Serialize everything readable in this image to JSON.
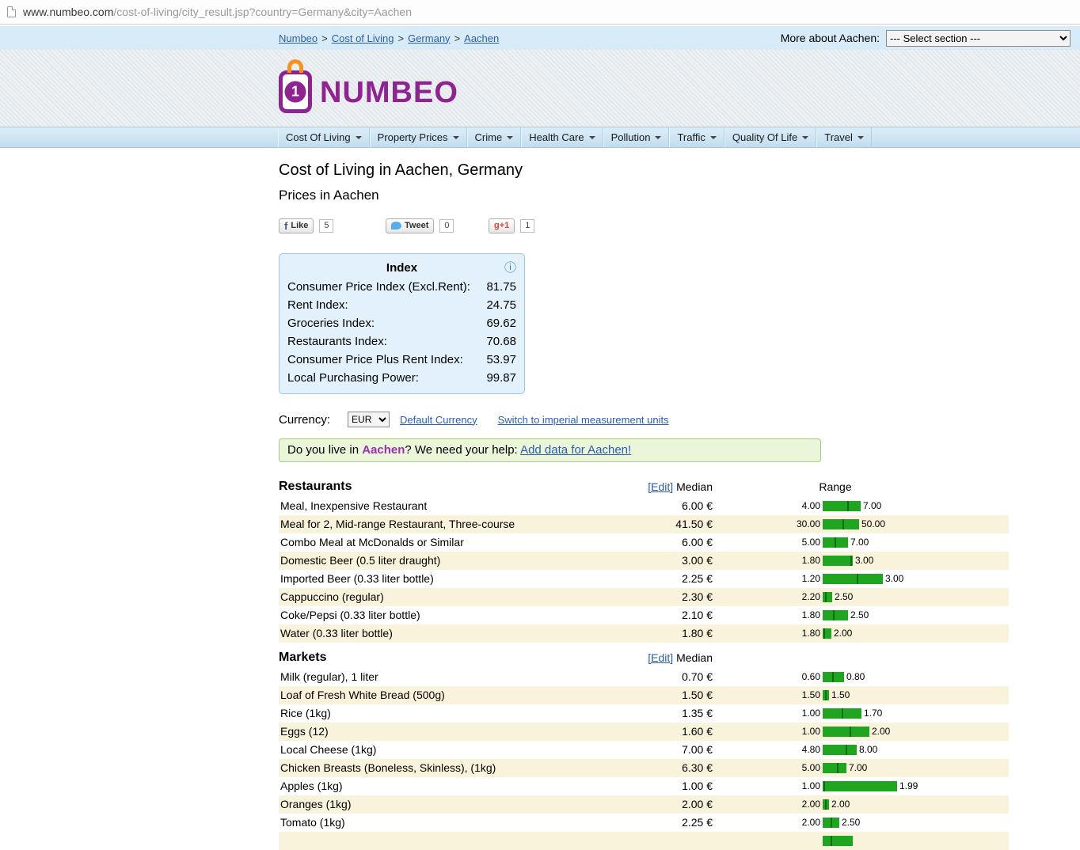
{
  "browser": {
    "domain": "www.numbeo.com",
    "path": "/cost-of-living/city_result.jsp?country=Germany&city=Aachen"
  },
  "topbar": {
    "more_label": "More about Aachen:",
    "select_value": "--- Select section ---"
  },
  "breadcrumb": {
    "items": [
      "Numbeo",
      "Cost of Living",
      "Germany",
      "Aachen"
    ],
    "separator": ">"
  },
  "logo": {
    "badge": "1",
    "text": "NUMBEO"
  },
  "nav": {
    "items": [
      "Cost Of Living",
      "Property Prices",
      "Crime",
      "Health Care",
      "Pollution",
      "Traffic",
      "Quality Of Life",
      "Travel"
    ]
  },
  "page": {
    "title": "Cost of Living in Aachen, Germany",
    "subtitle": "Prices in Aachen"
  },
  "social": {
    "fb_icon": "f",
    "like": "Like",
    "like_count": "5",
    "tweet": "Tweet",
    "tweet_count": "0",
    "gplus": "g+1",
    "gplus_count": "1"
  },
  "icons": {
    "info": "ⓘ"
  },
  "index_box": {
    "title": "Index",
    "rows": [
      {
        "label": "Consumer Price Index (Excl.Rent):",
        "value": "81.75"
      },
      {
        "label": "Rent Index:",
        "value": "24.75"
      },
      {
        "label": "Groceries Index:",
        "value": "69.62"
      },
      {
        "label": "Restaurants Index:",
        "value": "70.68"
      },
      {
        "label": "Consumer Price Plus Rent Index:",
        "value": "53.97"
      },
      {
        "label": "Local Purchasing Power:",
        "value": "99.87"
      }
    ]
  },
  "currency": {
    "label": "Currency:",
    "value": "EUR",
    "default_link": "Default Currency",
    "imperial_link": "Switch to imperial measurement units"
  },
  "help_box": {
    "prefix": "Do you live in",
    "city": "Aachen",
    "middle": "? We need your help:",
    "link": "Add data for Aachen!"
  },
  "table": {
    "edit_link": "[Edit]",
    "median_label": "Median",
    "sections": [
      {
        "name": "Restaurants",
        "range": "Range",
        "rows": [
          {
            "item": "Meal, Inexpensive Restaurant",
            "price": "6.00 €",
            "low": "4.00",
            "high": "7.00"
          },
          {
            "item": "Meal for 2, Mid-range Restaurant, Three-course",
            "price": "41.50 €",
            "low": "30.00",
            "high": "50.00"
          },
          {
            "item": "Combo Meal at McDonalds or Similar",
            "price": "6.00 €",
            "low": "5.00",
            "high": "7.00"
          },
          {
            "item": "Domestic Beer (0.5 liter draught)",
            "price": "3.00 €",
            "low": "1.80",
            "high": "3.00"
          },
          {
            "item": "Imported Beer (0.33 liter bottle)",
            "price": "2.25 €",
            "low": "1.20",
            "high": "3.00"
          },
          {
            "item": "Cappuccino (regular)",
            "price": "2.30 €",
            "low": "2.20",
            "high": "2.50"
          },
          {
            "item": "Coke/Pepsi (0.33 liter bottle)",
            "price": "2.10 €",
            "low": "1.80",
            "high": "2.50"
          },
          {
            "item": "Water (0.33 liter bottle)",
            "price": "1.80 €",
            "low": "1.80",
            "high": "2.00"
          }
        ]
      },
      {
        "name": "Markets",
        "range": "",
        "rows": [
          {
            "item": "Milk (regular), 1 liter",
            "price": "0.70 €",
            "low": "0.60",
            "high": "0.80"
          },
          {
            "item": "Loaf of Fresh White Bread (500g)",
            "price": "1.50 €",
            "low": "1.50",
            "high": "1.50"
          },
          {
            "item": "Rice (1kg)",
            "price": "1.35 €",
            "low": "1.00",
            "high": "1.70"
          },
          {
            "item": "Eggs (12)",
            "price": "1.60 €",
            "low": "1.00",
            "high": "2.00"
          },
          {
            "item": "Local Cheese (1kg)",
            "price": "7.00 €",
            "low": "4.80",
            "high": "8.00"
          },
          {
            "item": "Chicken Breasts (Boneless, Skinless), (1kg)",
            "price": "6.30 €",
            "low": "5.00",
            "high": "7.00"
          },
          {
            "item": "Apples (1kg)",
            "price": "1.00 €",
            "low": "1.00",
            "high": "1.99"
          },
          {
            "item": "Oranges (1kg)",
            "price": "2.00 €",
            "low": "2.00",
            "high": "2.00"
          },
          {
            "item": "Tomato (1kg)",
            "price": "2.25 €",
            "low": "2.00",
            "high": "2.50"
          },
          {
            "item": "",
            "price": "",
            "low": "",
            "high": "",
            "partial_bar": 38
          }
        ]
      }
    ]
  }
}
